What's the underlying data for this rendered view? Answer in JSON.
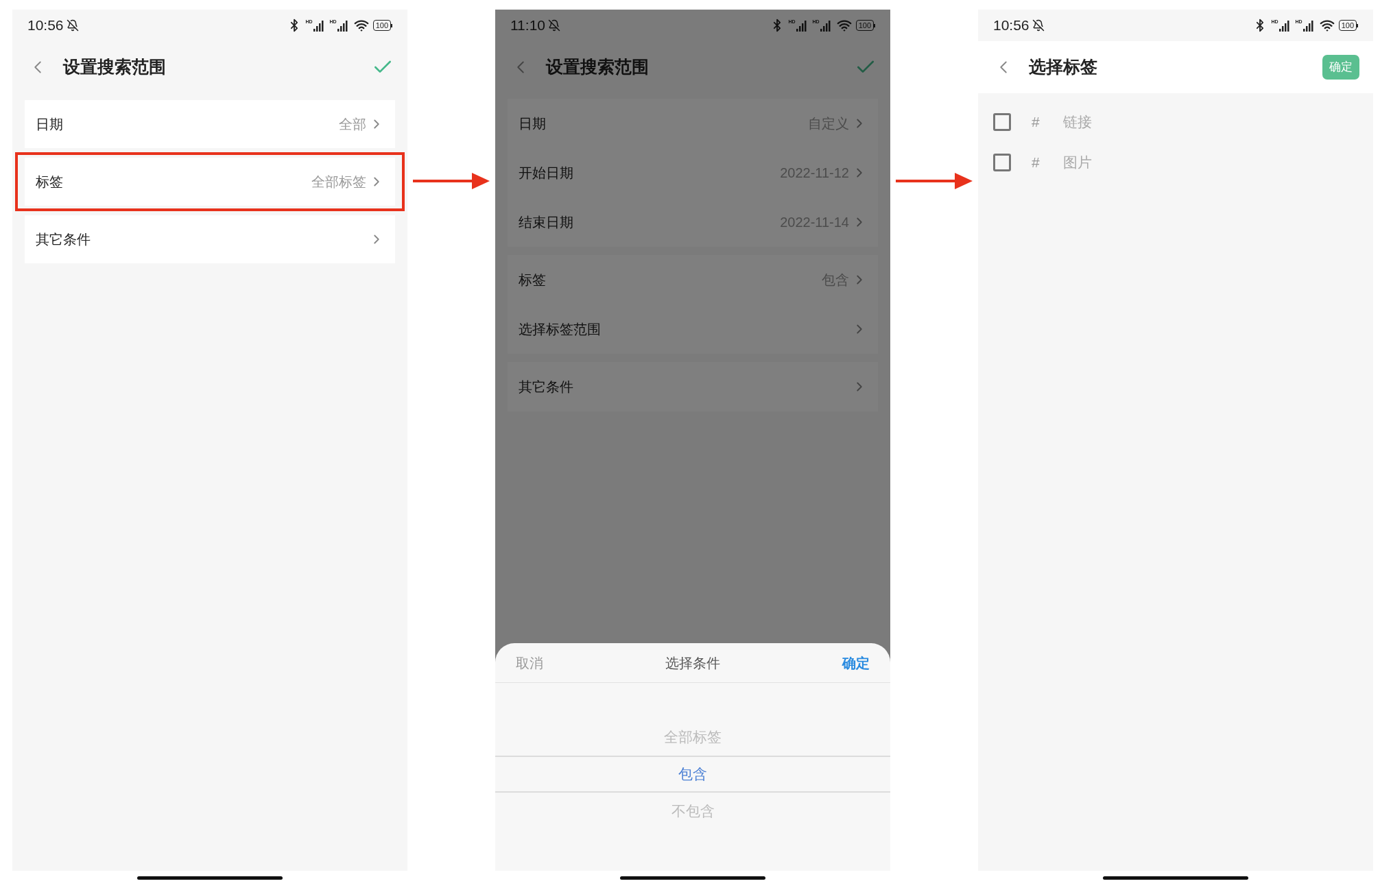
{
  "screens": [
    {
      "kind": "settings",
      "dimmed": false,
      "status": {
        "time": "10:56",
        "icons": [
          {
            "kind": "bluetooth"
          },
          {
            "kind": "signal",
            "label": "HD"
          },
          {
            "kind": "signal",
            "label": "HD"
          },
          {
            "kind": "wifi"
          },
          {
            "kind": "battery",
            "label": "100"
          }
        ]
      },
      "header": {
        "title": "设置搜索范围",
        "kind": "check"
      },
      "groups": [
        {
          "rows": [
            {
              "label": "日期",
              "value": "全部",
              "highlighted": false
            }
          ]
        },
        {
          "rows": [
            {
              "label": "标签",
              "value": "全部标签",
              "highlighted": true
            }
          ]
        },
        {
          "rows": [
            {
              "label": "其它条件",
              "highlighted": false
            }
          ]
        }
      ]
    },
    {
      "kind": "settings",
      "dimmed": true,
      "status": {
        "time": "11:10",
        "icons": [
          {
            "kind": "bluetooth"
          },
          {
            "kind": "signal",
            "label": "HD"
          },
          {
            "kind": "signal",
            "label": "HD"
          },
          {
            "kind": "wifi"
          },
          {
            "kind": "battery",
            "label": "100"
          }
        ]
      },
      "header": {
        "title": "设置搜索范围",
        "kind": "check"
      },
      "groups": [
        {
          "rows": [
            {
              "label": "日期",
              "value": "自定义",
              "highlighted": false
            },
            {
              "label": "开始日期",
              "value": "2022-11-12",
              "highlighted": false
            },
            {
              "label": "结束日期",
              "value": "2022-11-14",
              "highlighted": false
            }
          ]
        },
        {
          "rows": [
            {
              "label": "标签",
              "value": "包含",
              "highlighted": false
            },
            {
              "label": "选择标签范围",
              "highlighted": false
            }
          ]
        },
        {
          "rows": [
            {
              "label": "其它条件",
              "highlighted": false
            }
          ]
        }
      ],
      "sheet": {
        "cancel": "取消",
        "title": "选择条件",
        "confirm": "确定",
        "options": [
          {
            "label": "全部标签",
            "selected": false
          },
          {
            "label": "包含",
            "selected": true
          },
          {
            "label": "不包含",
            "selected": false
          }
        ]
      }
    },
    {
      "kind": "tag_picker",
      "dimmed": false,
      "status": {
        "time": "10:56",
        "icons": [
          {
            "kind": "bluetooth"
          },
          {
            "kind": "signal",
            "label": "HD"
          },
          {
            "kind": "signal",
            "label": "HD"
          },
          {
            "kind": "wifi"
          },
          {
            "kind": "battery",
            "label": "100"
          }
        ]
      },
      "header": {
        "title": "选择标签",
        "kind": "button",
        "button": "确定"
      },
      "tags": [
        {
          "hash": "#",
          "label": "链接",
          "checked": false
        },
        {
          "hash": "#",
          "label": "图片",
          "checked": false
        }
      ]
    }
  ]
}
